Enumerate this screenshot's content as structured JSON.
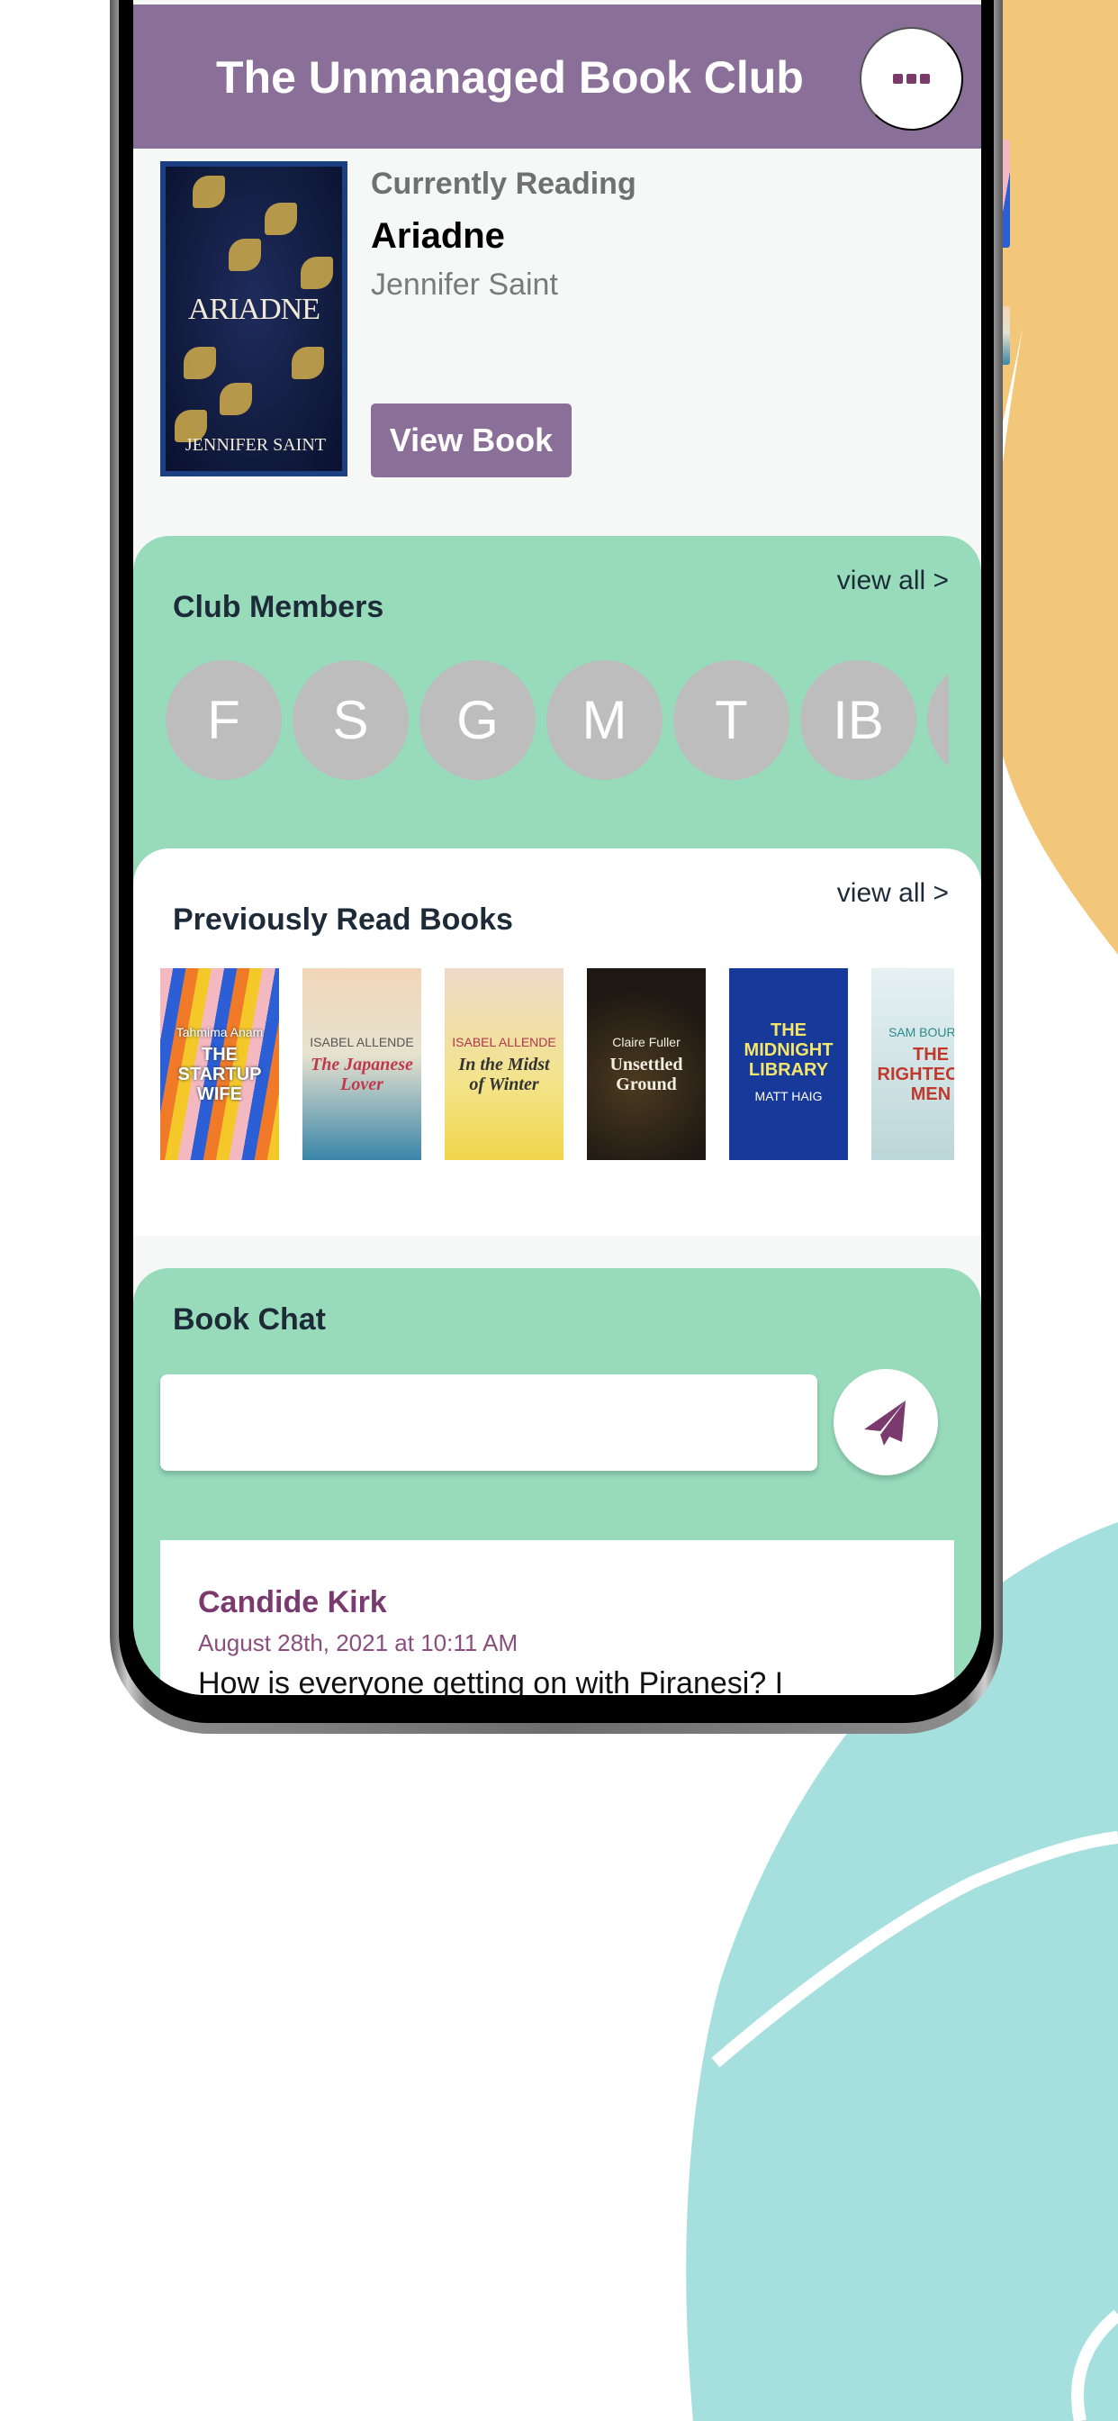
{
  "app": {
    "title": "The Unmanaged Book Club",
    "menu_icon": "more-dots-icon"
  },
  "current_reading": {
    "label": "Currently Reading",
    "title": "Ariadne",
    "author": "Jennifer Saint",
    "cover_title": "ARIADNE",
    "cover_author": "JENNIFER SAINT",
    "view_button": "View Book"
  },
  "members": {
    "title": "Club Members",
    "view_all": "view all >",
    "list": [
      "F",
      "S",
      "G",
      "M",
      "T",
      "IB",
      ""
    ]
  },
  "previous_books": {
    "title": "Previously Read Books",
    "view_all": "view all >",
    "list": [
      {
        "author": "Tahmima Anam",
        "title": "THE STARTUP WIFE"
      },
      {
        "author": "ISABEL ALLENDE",
        "title": "The Japanese Lover"
      },
      {
        "author": "ISABEL ALLENDE",
        "title": "In the Midst of Winter"
      },
      {
        "author": "Claire Fuller",
        "title": "Unsettled Ground"
      },
      {
        "author": "MATT HAIG",
        "title": "THE MIDNIGHT LIBRARY"
      },
      {
        "author": "SAM BOURNE",
        "title": "THE RIGHTEOUS MEN"
      }
    ]
  },
  "chat": {
    "title": "Book Chat",
    "input_value": "",
    "input_placeholder": "",
    "send_icon": "paper-plane-icon",
    "messages": [
      {
        "author": "Candide Kirk",
        "timestamp": "August 28th, 2021 at 10:11 AM",
        "text": "How is everyone getting on with Piranesi? I"
      }
    ]
  },
  "colors": {
    "header": "#8a7098",
    "accent_dark": "#7a3a6e",
    "card_green": "#97dbbb",
    "avatar_gray": "#bdbdbd",
    "bg_orange": "#f2c77a",
    "bg_teal": "#a6e0de"
  }
}
